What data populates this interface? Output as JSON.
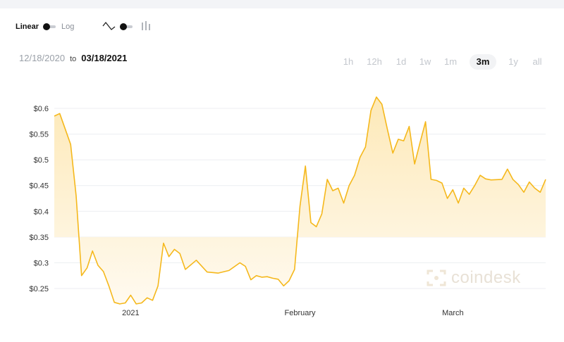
{
  "scale_toggle": {
    "linear_label": "Linear",
    "log_label": "Log"
  },
  "chart_style_toggle": {
    "left_icon": "line-chart-icon",
    "right_icon": "bar-chart-icon"
  },
  "date_range": {
    "start": "12/18/2020",
    "separator": "to",
    "end": "03/18/2021"
  },
  "time_ranges": [
    "1h",
    "12h",
    "1d",
    "1w",
    "1m",
    "3m",
    "1y",
    "all"
  ],
  "active_range": "3m",
  "watermark": {
    "text": "coindesk",
    "icon": "coindesk-logo-icon"
  },
  "colors": {
    "line": "#f5b81c",
    "fill_top": "#fde9b8",
    "fill_bottom": "#fffaf0",
    "grid": "#eceef1"
  },
  "chart_data": {
    "type": "area",
    "title": "",
    "xlabel": "",
    "ylabel": "",
    "x_tick_labels": [
      "2021",
      "February",
      "March"
    ],
    "x_tick_dates": [
      "2021-01-01",
      "2021-02-01",
      "2021-03-01"
    ],
    "y_ticks": [
      0.25,
      0.3,
      0.35,
      0.4,
      0.45,
      0.5,
      0.55,
      0.6
    ],
    "y_tick_labels": [
      "$0.25",
      "$0.3",
      "$0.35",
      "$0.4",
      "$0.45",
      "$0.5",
      "$0.55",
      "$0.6"
    ],
    "ylim": [
      0.22,
      0.62
    ],
    "xlim": [
      "2020-12-18",
      "2021-03-18"
    ],
    "grid": true,
    "series": [
      {
        "x": [
          "2020-12-18",
          "2020-12-19",
          "2020-12-20",
          "2020-12-21",
          "2020-12-22",
          "2020-12-23",
          "2020-12-24",
          "2020-12-25",
          "2020-12-26",
          "2020-12-27",
          "2020-12-28",
          "2020-12-29",
          "2020-12-30",
          "2020-12-31",
          "2021-01-01",
          "2021-01-02",
          "2021-01-03",
          "2021-01-04",
          "2021-01-05",
          "2021-01-06",
          "2021-01-07",
          "2021-01-08",
          "2021-01-09",
          "2021-01-10",
          "2021-01-11",
          "2021-01-13",
          "2021-01-15",
          "2021-01-17",
          "2021-01-19",
          "2021-01-21",
          "2021-01-22",
          "2021-01-23",
          "2021-01-24",
          "2021-01-25",
          "2021-01-26",
          "2021-01-27",
          "2021-01-28",
          "2021-01-29",
          "2021-01-30",
          "2021-01-31",
          "2021-02-01",
          "2021-02-02",
          "2021-02-03",
          "2021-02-04",
          "2021-02-05",
          "2021-02-06",
          "2021-02-07",
          "2021-02-08",
          "2021-02-09",
          "2021-02-10",
          "2021-02-11",
          "2021-02-12",
          "2021-02-13",
          "2021-02-14",
          "2021-02-15",
          "2021-02-16",
          "2021-02-17",
          "2021-02-18",
          "2021-02-19",
          "2021-02-20",
          "2021-02-21",
          "2021-02-22",
          "2021-02-23",
          "2021-02-24",
          "2021-02-25",
          "2021-02-26",
          "2021-02-27",
          "2021-02-28",
          "2021-03-01",
          "2021-03-02",
          "2021-03-03",
          "2021-03-04",
          "2021-03-05",
          "2021-03-06",
          "2021-03-07",
          "2021-03-08",
          "2021-03-10",
          "2021-03-11",
          "2021-03-12",
          "2021-03-13",
          "2021-03-14",
          "2021-03-15",
          "2021-03-16",
          "2021-03-17",
          "2021-03-18"
        ],
        "y": [
          0.585,
          0.59,
          0.56,
          0.53,
          0.43,
          0.275,
          0.29,
          0.323,
          0.295,
          0.283,
          0.255,
          0.223,
          0.22,
          0.222,
          0.237,
          0.22,
          0.222,
          0.232,
          0.227,
          0.255,
          0.338,
          0.312,
          0.326,
          0.318,
          0.287,
          0.305,
          0.282,
          0.28,
          0.285,
          0.3,
          0.293,
          0.267,
          0.275,
          0.272,
          0.273,
          0.27,
          0.268,
          0.255,
          0.265,
          0.287,
          0.41,
          0.488,
          0.378,
          0.37,
          0.395,
          0.462,
          0.44,
          0.445,
          0.416,
          0.45,
          0.47,
          0.505,
          0.525,
          0.596,
          0.622,
          0.608,
          0.56,
          0.513,
          0.54,
          0.537,
          0.565,
          0.492,
          0.534,
          0.574,
          0.462,
          0.46,
          0.455,
          0.425,
          0.442,
          0.416,
          0.445,
          0.433,
          0.45,
          0.47,
          0.463,
          0.461,
          0.462,
          0.482,
          0.462,
          0.452,
          0.437,
          0.457,
          0.445,
          0.437,
          0.462
        ]
      }
    ]
  }
}
